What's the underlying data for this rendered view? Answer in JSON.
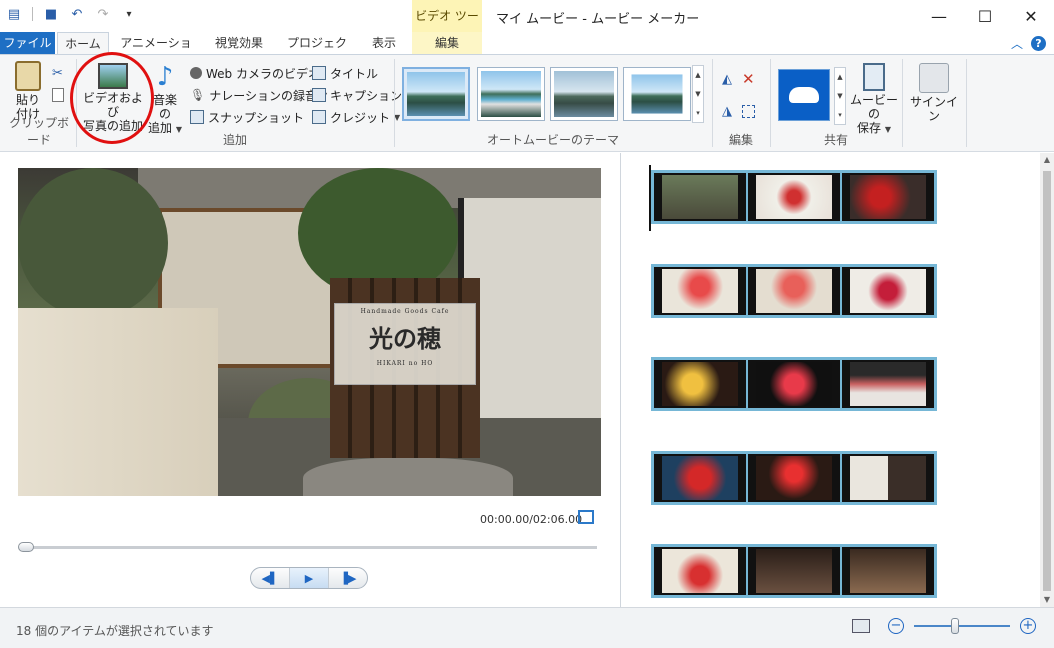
{
  "window": {
    "title": "マイ ムービー - ムービー メーカー",
    "contextual_tab_group": "ビデオ ツール"
  },
  "tabs": [
    {
      "label": "ファイル"
    },
    {
      "label": "ホーム"
    },
    {
      "label": "アニメーション"
    },
    {
      "label": "視覚効果"
    },
    {
      "label": "プロジェクト"
    },
    {
      "label": "表示"
    },
    {
      "label": "編集"
    }
  ],
  "ribbon": {
    "clipboard": {
      "paste_line1": "貼り",
      "paste_line2": "付け",
      "group_label": "クリップボード"
    },
    "add": {
      "add_video_line1": "ビデオおよび",
      "add_video_line2": "写真の追加",
      "add_music_line1": "音楽の",
      "add_music_line2": "追加",
      "webcam": "Web カメラのビデオ",
      "narration": "ナレーションの録音",
      "snapshot": "スナップショット",
      "title": "タイトル",
      "caption": "キャプション",
      "credits": "クレジット",
      "group_label": "追加"
    },
    "themes": {
      "group_label": "オートムービーのテーマ"
    },
    "edit": {
      "group_label": "編集"
    },
    "share": {
      "save_movie_line1": "ムービーの",
      "save_movie_line2": "保存",
      "group_label": "共有"
    },
    "signin": {
      "label": "サインイン"
    }
  },
  "preview": {
    "sign_text": "光の穂",
    "sign_top_text": "Handmade Goods Cafe",
    "sign_sub": "HIKARI no HO",
    "timecode": "00:00.00/02:06.00",
    "seek_position": 0.0
  },
  "storyboard": {
    "rows": 5,
    "items_per_row": 3
  },
  "statusbar": {
    "text": "18 個のアイテムが選択されています",
    "zoom_level": 0.42
  },
  "colors": {
    "file_tab": "#1e6fc4",
    "contextual_tab": "#fdf4b6",
    "storyboard_frame": "#76b7d6",
    "annotation": "#e01010"
  }
}
